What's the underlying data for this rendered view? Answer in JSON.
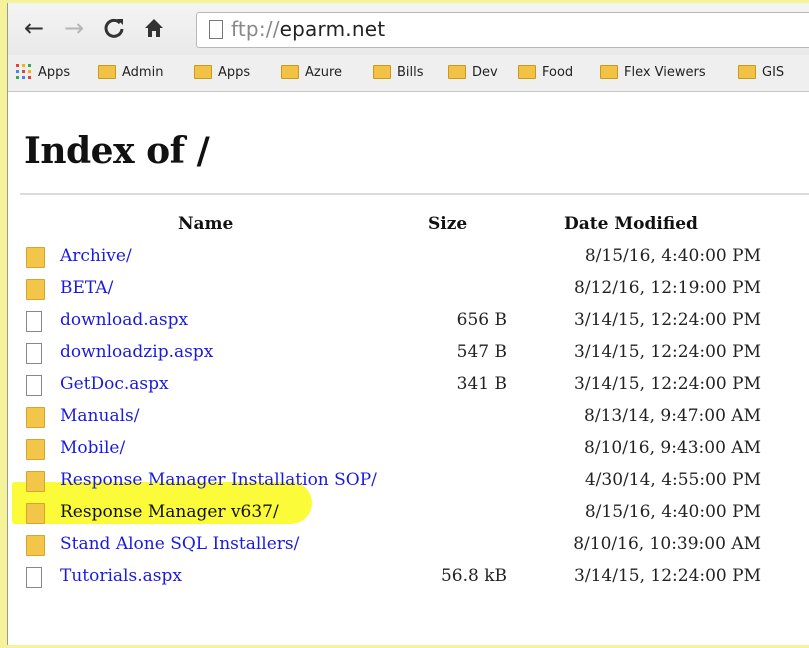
{
  "browser": {
    "url_scheme": "ftp://",
    "url_host": "eparm.net"
  },
  "bookmarks": [
    {
      "label": "Apps",
      "icon": "apps-grid-icon"
    },
    {
      "label": "Admin",
      "icon": "folder-icon"
    },
    {
      "label": "Apps",
      "icon": "folder-icon"
    },
    {
      "label": "Azure",
      "icon": "folder-icon"
    },
    {
      "label": "Bills",
      "icon": "folder-icon"
    },
    {
      "label": "Dev",
      "icon": "folder-icon"
    },
    {
      "label": "Food",
      "icon": "folder-icon"
    },
    {
      "label": "Flex Viewers",
      "icon": "folder-icon"
    },
    {
      "label": "GIS",
      "icon": "folder-icon"
    }
  ],
  "page": {
    "title": "Index of /",
    "columns": {
      "name": "Name",
      "size": "Size",
      "date": "Date Modified"
    },
    "entries": [
      {
        "type": "folder",
        "name": "Archive/",
        "size": "",
        "date": "8/15/16, 4:40:00 PM"
      },
      {
        "type": "folder",
        "name": "BETA/",
        "size": "",
        "date": "8/12/16, 12:19:00 PM"
      },
      {
        "type": "file",
        "name": "download.aspx",
        "size": "656 B",
        "date": "3/14/15, 12:24:00 PM"
      },
      {
        "type": "file",
        "name": "downloadzip.aspx",
        "size": "547 B",
        "date": "3/14/15, 12:24:00 PM"
      },
      {
        "type": "file",
        "name": "GetDoc.aspx",
        "size": "341 B",
        "date": "3/14/15, 12:24:00 PM"
      },
      {
        "type": "folder",
        "name": "Manuals/",
        "size": "",
        "date": "8/13/14, 9:47:00 AM"
      },
      {
        "type": "folder",
        "name": "Mobile/",
        "size": "",
        "date": "8/10/16, 9:43:00 AM"
      },
      {
        "type": "folder",
        "name": "Response Manager Installation SOP/",
        "size": "",
        "date": "4/30/14, 4:55:00 PM"
      },
      {
        "type": "folder",
        "name": "Response Manager v637/",
        "size": "",
        "date": "8/15/16, 4:40:00 PM",
        "highlighted": true
      },
      {
        "type": "folder",
        "name": "Stand Alone SQL Installers/",
        "size": "",
        "date": "8/10/16, 10:39:00 AM"
      },
      {
        "type": "file",
        "name": "Tutorials.aspx",
        "size": "56.8 kB",
        "date": "3/14/15, 12:24:00 PM"
      }
    ]
  },
  "colors": {
    "link": "#1a1adf",
    "highlight": "#fbfb3a",
    "folder": "#f3c64a"
  }
}
